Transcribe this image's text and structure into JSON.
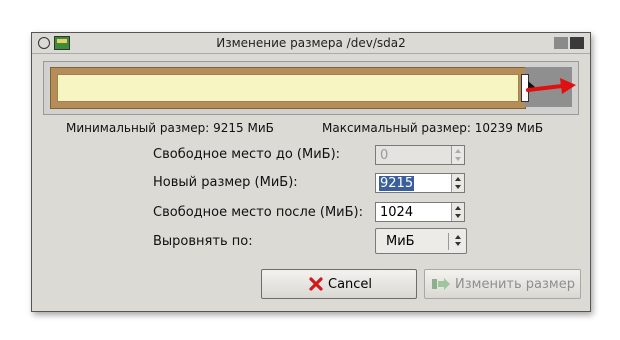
{
  "window": {
    "title": "Изменение размера /dev/sda2"
  },
  "partition": {
    "min_size_text": "Минимальный размер: 9215 МиБ",
    "max_size_text": "Максимальный размер: 10239 МиБ",
    "used_fraction": 0.9
  },
  "form": {
    "free_before": {
      "label": "Свободное место до (МиБ):",
      "value": "0"
    },
    "new_size": {
      "label": "Новый размер (МиБ):",
      "value": "9215"
    },
    "free_after": {
      "label": "Свободное место после (МиБ):",
      "value": "1024"
    },
    "align": {
      "label": "Выровнять по:",
      "value": "МиБ"
    }
  },
  "buttons": {
    "cancel": "Cancel",
    "apply": "Изменить размер"
  },
  "colors": {
    "partition_border": "#b68d59",
    "partition_fill": "#f7f5c1",
    "unallocated": "#8f8f8f",
    "arrow": "#e01010"
  },
  "icons": [
    "window-menu-icon",
    "app-icon",
    "minimize-icon",
    "maximize-icon",
    "resize-arrow-icon",
    "cancel-x-icon",
    "resize-apply-icon"
  ]
}
